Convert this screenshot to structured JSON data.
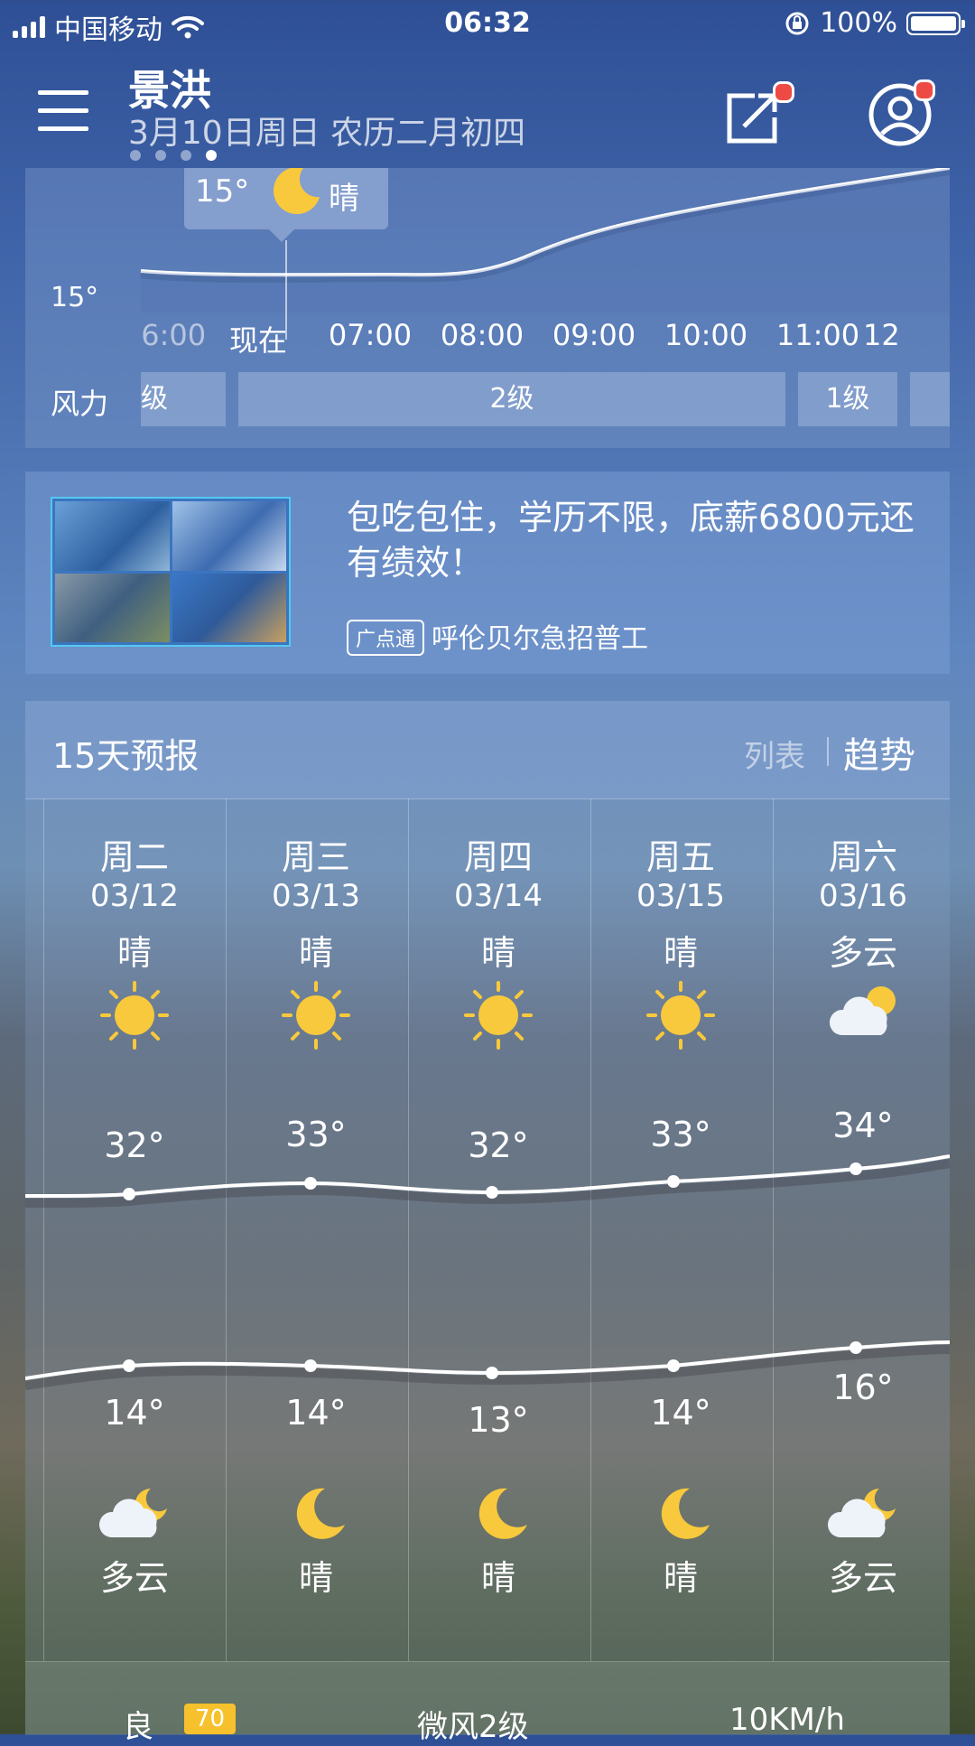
{
  "status_bar": {
    "carrier": "中国移动",
    "time": "06:32",
    "battery": "100%"
  },
  "header": {
    "city": "景洪",
    "date": "3月10日周日 农历二月初四",
    "page_count": 4,
    "active_page": 4
  },
  "hourly": {
    "tooltip": {
      "temp": "15°",
      "condition": "晴",
      "icon": "moon-icon"
    },
    "y_label": "15°",
    "hours": [
      "06:00",
      "现在",
      "07:00",
      "08:00",
      "09:00",
      "10:00",
      "11:00",
      "12"
    ],
    "wind_label": "风力",
    "wind_segments": [
      "级",
      "2级",
      "1级",
      ""
    ]
  },
  "ad": {
    "title": "包吃包住，学历不限，底薪6800元还有绩效！",
    "badge": "广点通",
    "source": "呼伦贝尔急招普工"
  },
  "forecast": {
    "title": "15天预报",
    "view_list": "列表",
    "view_trend": "趋势",
    "days": [
      {
        "weekday": "周二",
        "date": "03/12",
        "day_condition": "晴",
        "day_icon": "sun-icon",
        "high": "32°",
        "low": "14°",
        "night_icon": "cloud-moon-icon",
        "night_condition": "多云"
      },
      {
        "weekday": "周三",
        "date": "03/13",
        "day_condition": "晴",
        "day_icon": "sun-icon",
        "high": "33°",
        "low": "14°",
        "night_icon": "moon-icon",
        "night_condition": "晴"
      },
      {
        "weekday": "周四",
        "date": "03/14",
        "day_condition": "晴",
        "day_icon": "sun-icon",
        "high": "32°",
        "low": "13°",
        "night_icon": "moon-icon",
        "night_condition": "晴"
      },
      {
        "weekday": "周五",
        "date": "03/15",
        "day_condition": "晴",
        "day_icon": "sun-icon",
        "high": "33°",
        "low": "14°",
        "night_icon": "moon-icon",
        "night_condition": "晴"
      },
      {
        "weekday": "周六",
        "date": "03/16",
        "day_condition": "多云",
        "day_icon": "cloud-sun-icon",
        "high": "34°",
        "low": "16°",
        "night_icon": "cloud-moon-icon",
        "night_condition": "多云"
      }
    ],
    "bottom": {
      "quality": "良",
      "aqi": "70",
      "wind": "微风2级",
      "visibility": "10KM/h"
    }
  },
  "colors": {
    "accent_red": "#ef4b45",
    "sun": "#f8c93c",
    "aqi_badge": "#f6c12c"
  }
}
